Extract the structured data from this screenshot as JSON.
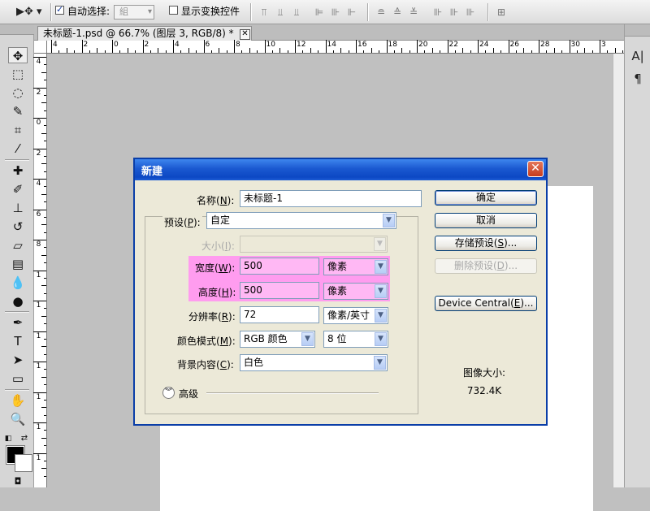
{
  "options_bar": {
    "auto_select_label": "自动选择:",
    "auto_select_checked": true,
    "auto_select_dropdown": "組",
    "show_transform_label": "显示变换控件",
    "show_transform_checked": false
  },
  "document_tab": {
    "title": "未标题-1.psd @ 66.7% (图层 3, RGB/8) *",
    "close_symbol": "✕"
  },
  "rulers": {
    "horizontal": [
      "4",
      "2",
      "0",
      "2",
      "4",
      "6",
      "8",
      "10",
      "12",
      "14",
      "16",
      "18",
      "20",
      "22",
      "24",
      "26",
      "28",
      "30",
      "3"
    ],
    "vertical": [
      "4",
      "2",
      "0",
      "2",
      "4",
      "6",
      "8",
      "1",
      "1",
      "1",
      "1",
      "1",
      "1",
      "1",
      "2"
    ]
  },
  "dialog": {
    "title": "新建",
    "name": {
      "label": "名称(",
      "key": "N",
      "suffix": "):",
      "value": "未标题-1"
    },
    "preset": {
      "label": "预设(",
      "key": "P",
      "suffix": "):",
      "value": "自定"
    },
    "size": {
      "label": "大小(",
      "key": "I",
      "suffix": "):",
      "value": ""
    },
    "width": {
      "label": "宽度(",
      "key": "W",
      "suffix": "):",
      "value": "500",
      "unit": "像素"
    },
    "height": {
      "label": "高度(",
      "key": "H",
      "suffix": "):",
      "value": "500",
      "unit": "像素"
    },
    "resolution": {
      "label": "分辨率(",
      "key": "R",
      "suffix": "):",
      "value": "72",
      "unit": "像素/英寸"
    },
    "color_mode": {
      "label": "颜色模式(",
      "key": "M",
      "suffix": "):",
      "value": "RGB 颜色",
      "bits": "8 位"
    },
    "background": {
      "label": "背景内容(",
      "key": "C",
      "suffix": "):",
      "value": "白色"
    },
    "advanced_label": "高级",
    "buttons": {
      "ok": "确定",
      "cancel": "取消",
      "save_preset": {
        "label": "存储预设(",
        "key": "S",
        "suffix": ")..."
      },
      "delete_preset": {
        "label": "删除预设(",
        "key": "D",
        "suffix": ")..."
      },
      "device_central": {
        "label": "Device Central(",
        "key": "E",
        "suffix": ")..."
      }
    },
    "image_size_label": "图像大小:",
    "image_size_value": "732.4K"
  },
  "colors": {
    "highlight": "#ff9cef",
    "field_highlight": "#ffb8f4",
    "title_bar": "#1a58d0",
    "dialog_bg": "#ece9d8"
  },
  "tool_icons": [
    "move-tool-icon",
    "marquee-tool-icon",
    "lasso-tool-icon",
    "quick-select-tool-icon",
    "crop-tool-icon",
    "eyedropper-tool-icon",
    "healing-brush-tool-icon",
    "brush-tool-icon",
    "clone-stamp-tool-icon",
    "history-brush-tool-icon",
    "eraser-tool-icon",
    "gradient-tool-icon",
    "blur-tool-icon",
    "dodge-tool-icon",
    "pen-tool-icon",
    "type-tool-icon",
    "path-select-tool-icon",
    "shape-tool-icon",
    "hand-tool-icon",
    "zoom-tool-icon"
  ]
}
